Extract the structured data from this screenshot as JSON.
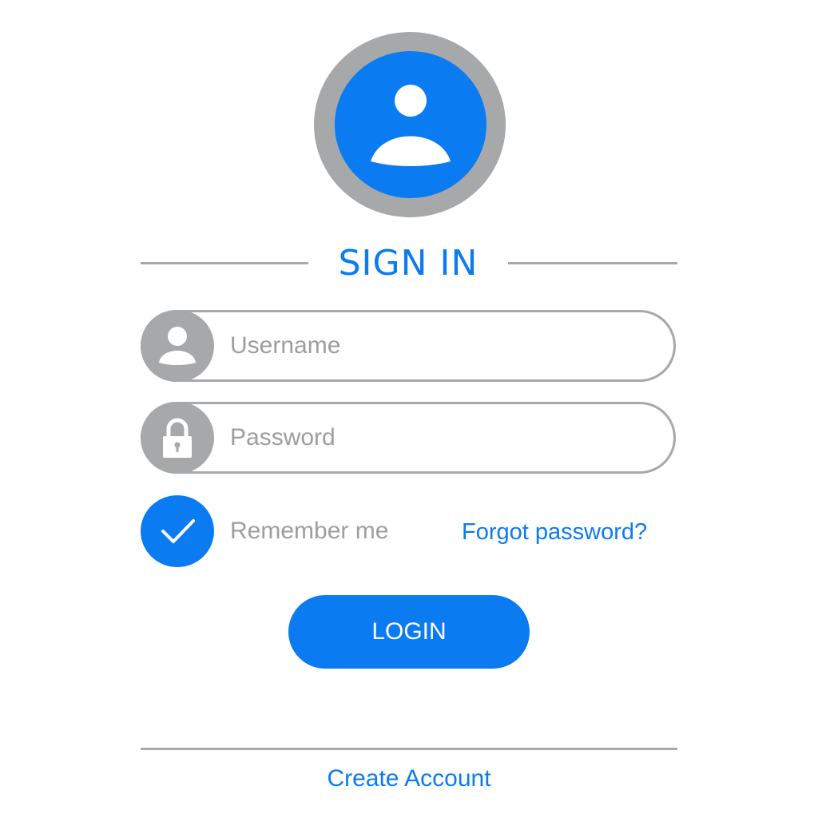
{
  "header": {
    "avatar_icon": "user-avatar-icon",
    "title": "SIGN IN"
  },
  "form": {
    "username": {
      "icon": "user-icon",
      "placeholder": "Username",
      "value": ""
    },
    "password": {
      "icon": "lock-icon",
      "placeholder": "Password",
      "value": ""
    },
    "remember": {
      "icon": "checkmark-icon",
      "checked": true,
      "label": "Remember me"
    },
    "forgot_label": "Forgot password?",
    "login_label": "LOGIN"
  },
  "footer": {
    "create_account_label": "Create Account"
  },
  "colors": {
    "accent": "#0b7bf2",
    "neutral": "#a7a8aa",
    "text_muted": "#9d9ea0",
    "background": "#ffffff"
  }
}
